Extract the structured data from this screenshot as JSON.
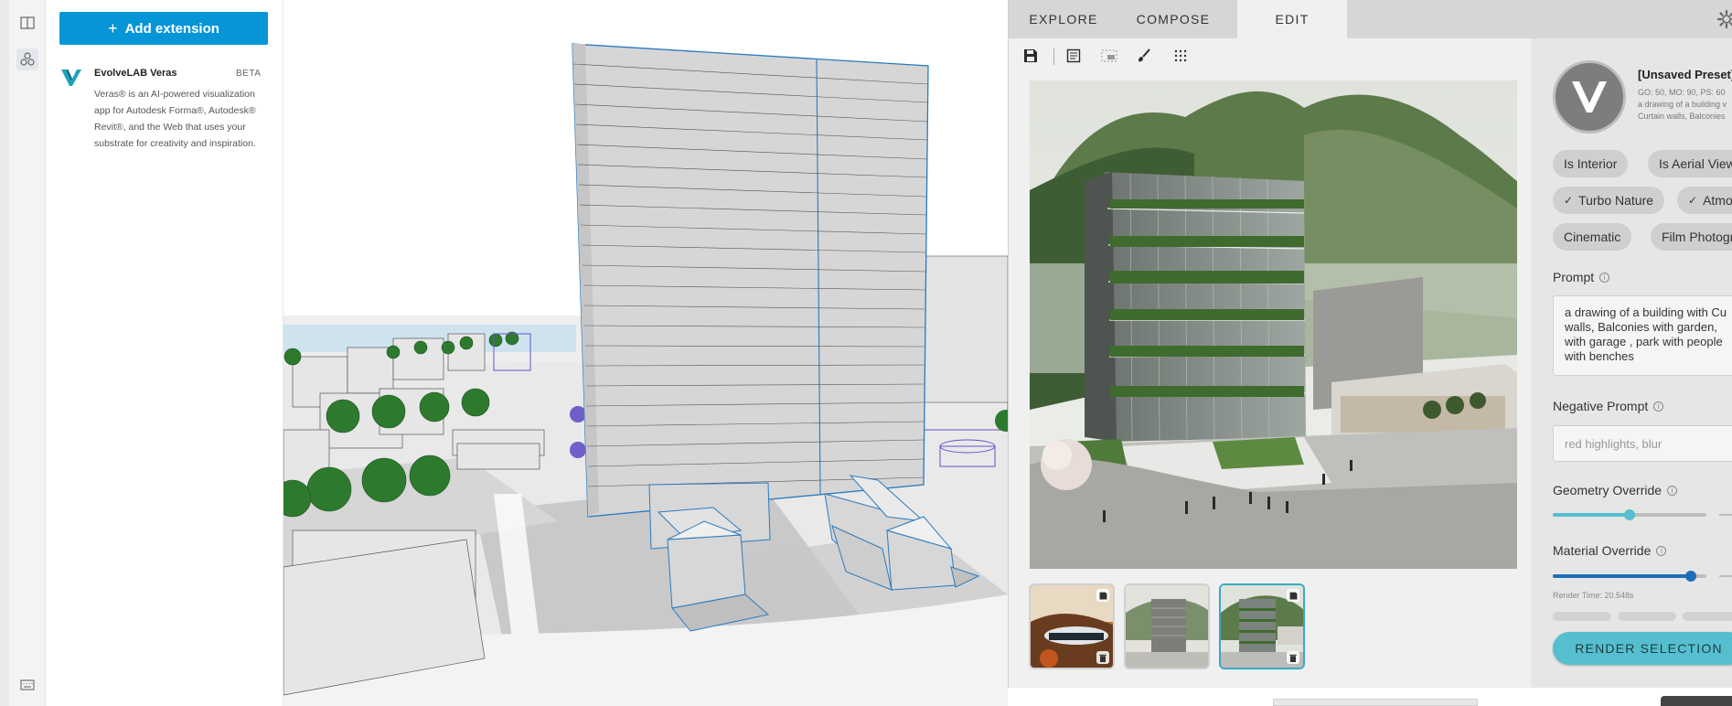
{
  "extension_panel": {
    "add_button_label": "Add extension",
    "item": {
      "name": "EvolveLAB Veras",
      "badge": "BETA",
      "description": "Veras® is an AI-powered visualization app for Autodesk Forma®, Autodesk® Revit®, and the Web that uses your substrate for creativity and inspiration."
    }
  },
  "veras": {
    "tabs": [
      "EXPLORE",
      "COMPOSE",
      "EDIT"
    ],
    "active_tab": "EDIT",
    "preset": {
      "title": "[Unsaved Preset]",
      "meta_line1": "GO: 50, MO: 90, PS: 60",
      "meta_line2": "a drawing of a building v",
      "meta_line3": "Curtain walls, Balconies"
    },
    "chips": [
      {
        "label": "Is Interior",
        "checked": false
      },
      {
        "label": "Is Aerial View",
        "checked": false
      },
      {
        "label": "Turbo Nature",
        "checked": true
      },
      {
        "label": "Atmos",
        "checked": true
      },
      {
        "label": "Cinematic",
        "checked": false
      },
      {
        "label": "Film Photogra",
        "checked": false
      }
    ],
    "prompt_label": "Prompt",
    "prompt_text": "a drawing of a building with Cu walls, Balconies with garden, with garage , park with people with benches",
    "negative_prompt_label": "Negative Prompt",
    "negative_prompt_placeholder": "red highlights, blur",
    "geometry_override_label": "Geometry Override",
    "geometry_override_value": 0.5,
    "material_override_label": "Material Override",
    "material_override_value": 0.9,
    "render_time": "Render Time: 20.548s",
    "render_button_label": "RENDER SELECTION",
    "colors": {
      "accent": "#55bfd0",
      "material_slider": "#1f6fb8",
      "geometry_slider": "#55bfd0",
      "add_button": "#0696d7"
    }
  }
}
